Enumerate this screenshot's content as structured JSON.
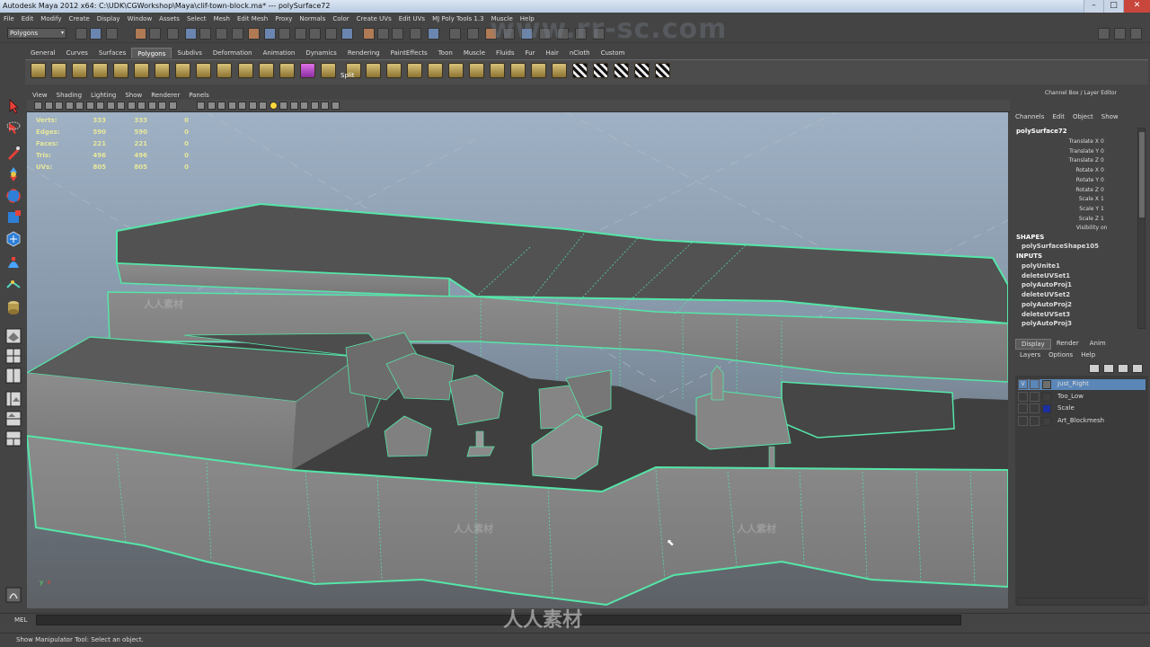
{
  "window": {
    "title": "Autodesk Maya 2012 x64: C:\\UDK\\CGWorkshop\\Maya\\clif-town-block.ma*  ---   polySurface72",
    "minimize": "–",
    "maximize": "□",
    "close": "✕"
  },
  "menubar": [
    "File",
    "Edit",
    "Modify",
    "Create",
    "Display",
    "Window",
    "Assets",
    "Select",
    "Mesh",
    "Edit Mesh",
    "Proxy",
    "Normals",
    "Color",
    "Create UVs",
    "Edit UVs",
    "MJ Poly Tools 1.3",
    "Muscle",
    "Help"
  ],
  "mode_selector": {
    "value": "Polygons",
    "arrow": "▾"
  },
  "shelf": {
    "tabs": [
      "General",
      "Curves",
      "Surfaces",
      "Polygons",
      "Subdivs",
      "Deformation",
      "Animation",
      "Dynamics",
      "Rendering",
      "PaintEffects",
      "Toon",
      "Muscle",
      "Fluids",
      "Fur",
      "Hair",
      "nCloth",
      "Custom"
    ],
    "active_tab": "Polygons",
    "split_label": "Split"
  },
  "panel_menu": [
    "View",
    "Shading",
    "Lighting",
    "Show",
    "Renderer",
    "Panels"
  ],
  "hud": {
    "rows": [
      {
        "label": "Verts:",
        "a": "333",
        "b": "333",
        "c": "0"
      },
      {
        "label": "Edges:",
        "a": "590",
        "b": "590",
        "c": "0"
      },
      {
        "label": "Faces:",
        "a": "221",
        "b": "221",
        "c": "0"
      },
      {
        "label": "Tris:",
        "a": "496",
        "b": "496",
        "c": "0"
      },
      {
        "label": "UVs:",
        "a": "805",
        "b": "805",
        "c": "0"
      }
    ]
  },
  "axis_label": {
    "y": "y",
    "x": "x"
  },
  "channel_box": {
    "header": "Channel Box / Layer Editor",
    "menu": [
      "Channels",
      "Edit",
      "Object",
      "Show"
    ],
    "object": "polySurface72",
    "attributes": [
      {
        "label": "Translate X",
        "value": "0"
      },
      {
        "label": "Translate Y",
        "value": "0"
      },
      {
        "label": "Translate Z",
        "value": "0"
      },
      {
        "label": "Rotate X",
        "value": "0"
      },
      {
        "label": "Rotate Y",
        "value": "0"
      },
      {
        "label": "Rotate Z",
        "value": "0"
      },
      {
        "label": "Scale X",
        "value": "1"
      },
      {
        "label": "Scale Y",
        "value": "1"
      },
      {
        "label": "Scale Z",
        "value": "1"
      },
      {
        "label": "Visibility",
        "value": "on"
      }
    ],
    "shapes_header": "SHAPES",
    "shapes": [
      "polySurfaceShape105"
    ],
    "inputs_header": "INPUTS",
    "inputs": [
      "polyUnite1",
      "deleteUVSet1",
      "polyAutoProj1",
      "deleteUVSet2",
      "polyAutoProj2",
      "deleteUVSet3",
      "polyAutoProj3"
    ]
  },
  "layer_editor": {
    "tabs": [
      "Display",
      "Render",
      "Anim"
    ],
    "active_tab": "Display",
    "menu": [
      "Layers",
      "Options",
      "Help"
    ],
    "layers": [
      {
        "name": "Just_Right",
        "visible": "V",
        "color": "#6e6e6e",
        "selected": true
      },
      {
        "name": "Too_Low",
        "visible": "",
        "color": "#3f3f3f",
        "selected": false
      },
      {
        "name": "Scale",
        "visible": "",
        "color": "#1c2fa0",
        "selected": false
      },
      {
        "name": "Art_Blockmesh",
        "visible": "",
        "color": "#3f3f3f",
        "selected": false
      }
    ]
  },
  "command_line": {
    "label": "MEL"
  },
  "help_line": "Show Manipulator Tool: Select an object.",
  "watermarks": {
    "url": "www.rr-sc.com",
    "cn": "人人素材",
    "logo": "人人素材"
  },
  "colors": {
    "wireframe_highlight": "#55e6a8",
    "viewport_top": "#9fb1c4",
    "viewport_bottom": "#5d6166",
    "selected_layer": "#5a86b8"
  }
}
